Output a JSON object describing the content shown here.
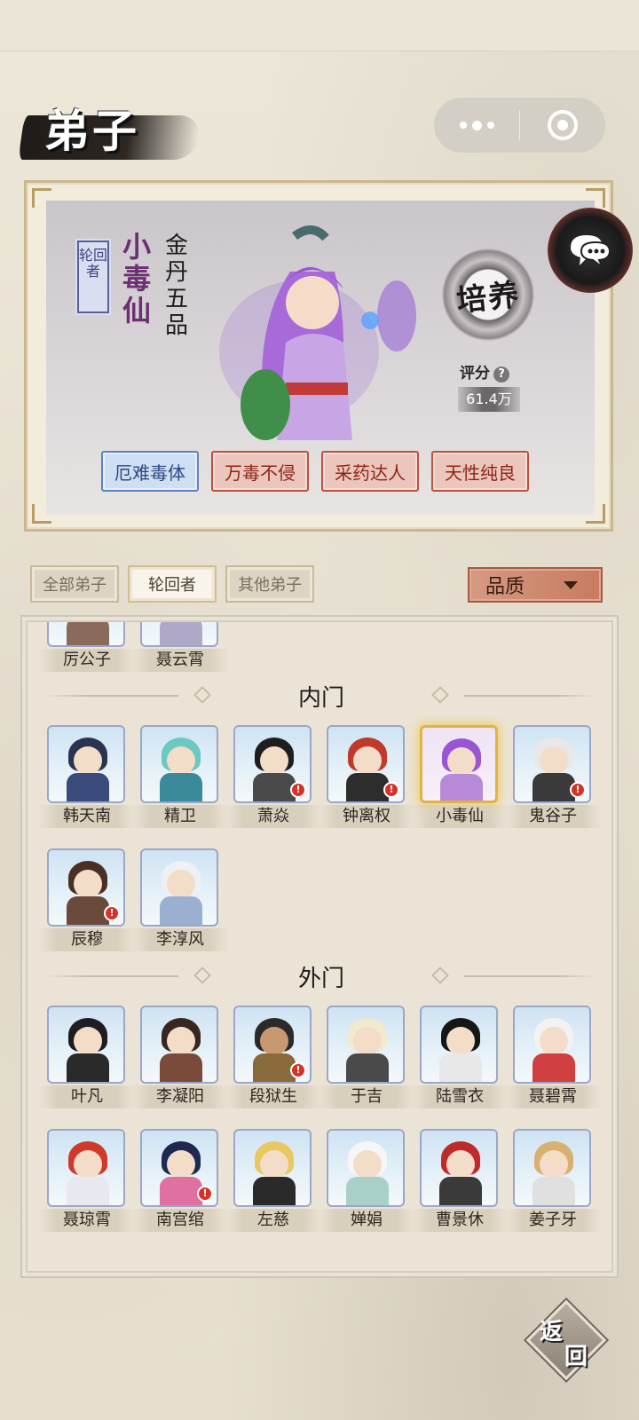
{
  "page": {
    "title": "弟子"
  },
  "hero": {
    "role_tag": "轮回者",
    "name": "小毒仙",
    "rank": "金丹五品",
    "cultivate_label": "培养",
    "score_label": "评分",
    "score_help_icon": "?",
    "score_value": "61.4万",
    "traits": [
      {
        "label": "厄难毒体",
        "style": "blue"
      },
      {
        "label": "万毒不侵",
        "style": "red"
      },
      {
        "label": "采药达人",
        "style": "red"
      },
      {
        "label": "天性纯良",
        "style": "red"
      }
    ]
  },
  "filters": {
    "tabs": [
      {
        "label": "全部弟子",
        "active": false
      },
      {
        "label": "轮回者",
        "active": true
      },
      {
        "label": "其他弟子",
        "active": false
      }
    ],
    "quality_label": "品质"
  },
  "list": {
    "top_partial": [
      {
        "name": "厉公子"
      },
      {
        "name": "聂云霄"
      }
    ],
    "sections": [
      {
        "title": "内门",
        "members": [
          {
            "name": "韩天南",
            "alert": false
          },
          {
            "name": "精卫",
            "alert": false
          },
          {
            "name": "萧焱",
            "alert": true
          },
          {
            "name": "钟离权",
            "alert": true
          },
          {
            "name": "小毒仙",
            "alert": false,
            "selected": true
          },
          {
            "name": "鬼谷子",
            "alert": true
          },
          {
            "name": "辰穆",
            "alert": true
          },
          {
            "name": "李淳风",
            "alert": false
          }
        ]
      },
      {
        "title": "外门",
        "members": [
          {
            "name": "叶凡",
            "alert": false
          },
          {
            "name": "李凝阳",
            "alert": false
          },
          {
            "name": "段狱生",
            "alert": true
          },
          {
            "name": "于吉",
            "alert": false
          },
          {
            "name": "陆雪衣",
            "alert": false
          },
          {
            "name": "聂碧霄",
            "alert": false
          },
          {
            "name": "聂琼霄",
            "alert": false
          },
          {
            "name": "南宫绾",
            "alert": true
          },
          {
            "name": "左慈",
            "alert": false
          },
          {
            "name": "婵娟",
            "alert": false
          },
          {
            "name": "曹景休",
            "alert": false
          },
          {
            "name": "姜子牙",
            "alert": false
          }
        ]
      }
    ]
  },
  "back_button": {
    "char1": "返",
    "char2": "回"
  },
  "colors": {
    "accent_purple": "#6d2f73",
    "trait_red": "#b9523f",
    "trait_blue": "#5d84c2",
    "alert_red": "#d5332a"
  }
}
